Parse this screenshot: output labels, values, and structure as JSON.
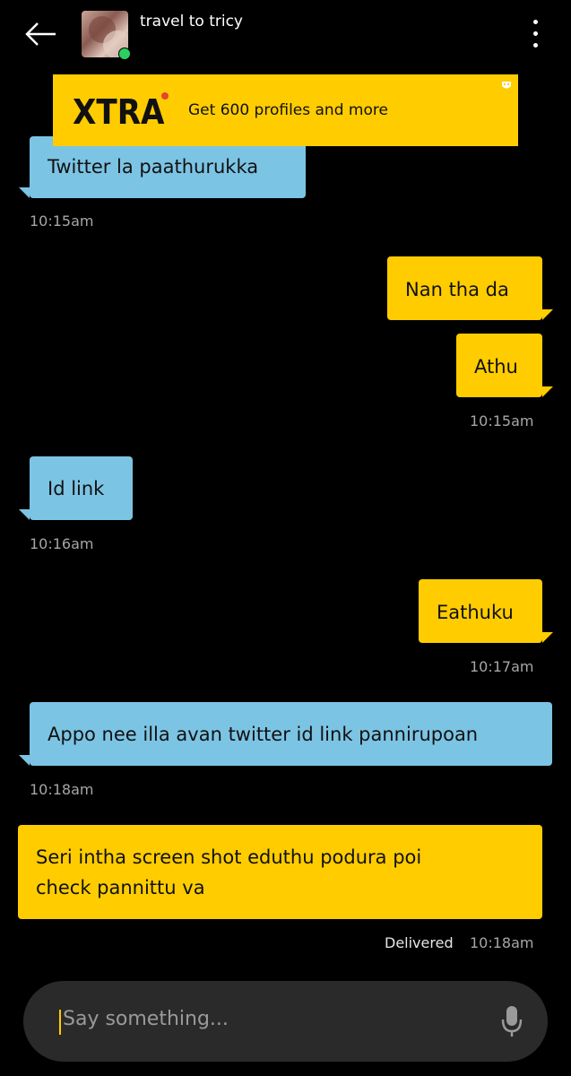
{
  "header": {
    "contact_name": "travel to tricy",
    "online": true
  },
  "ad": {
    "logo": "XTRA",
    "text": "Get 600 profiles and more"
  },
  "messages": [
    {
      "dir": "in",
      "text": "Twitter la paathurukka"
    },
    {
      "time": "10:15am"
    },
    {
      "dir": "out",
      "text": "Nan tha da"
    },
    {
      "dir": "out",
      "text": "Athu"
    },
    {
      "time": "10:15am"
    },
    {
      "dir": "in",
      "text": "Id link"
    },
    {
      "time": "10:16am"
    },
    {
      "dir": "out",
      "text": "Eathuku"
    },
    {
      "time": "10:17am"
    },
    {
      "dir": "in",
      "text": "Appo nee illa avan twitter id link pannirupoan"
    },
    {
      "time": "10:18am"
    },
    {
      "dir": "out",
      "lines": [
        "Seri intha screen shot eduthu podura poi",
        "check pannittu va"
      ]
    },
    {
      "status": "Delivered",
      "time": "10:18am"
    }
  ],
  "composer": {
    "placeholder": "Say something..."
  },
  "colors": {
    "incoming": "#7cc4e4",
    "outgoing": "#ffcc00",
    "background": "#000000"
  },
  "icons": [
    "arrow-left-icon",
    "more-vertical-icon",
    "ad-badge-icon",
    "microphone-icon"
  ]
}
